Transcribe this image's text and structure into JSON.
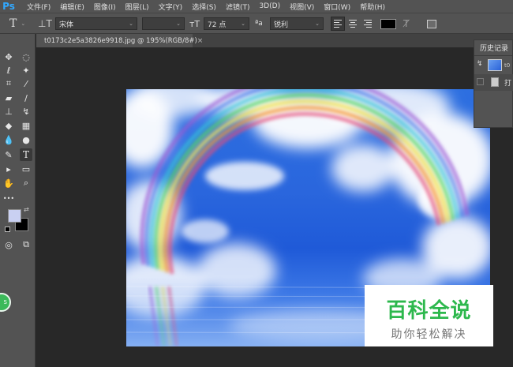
{
  "app": {
    "logo": "Ps"
  },
  "menu": [
    "文件(F)",
    "编辑(E)",
    "图像(I)",
    "图层(L)",
    "文字(Y)",
    "选择(S)",
    "滤镜(T)",
    "3D(D)",
    "视图(V)",
    "窗口(W)",
    "帮助(H)"
  ],
  "options": {
    "tool_glyph": "T",
    "font_family": "宋体",
    "font_style": "",
    "font_size": "72 点",
    "aa_label": "ªa",
    "antialias": "锐利",
    "text_color": "#000000"
  },
  "document": {
    "tab_title": "t0173c2e5a3826e9918.jpg @ 195%(RGB/8#)",
    "close": "×"
  },
  "history": {
    "title": "历史记录",
    "row1_text": "t0",
    "row2_text": "打"
  },
  "toolbar": {
    "dots": "•••"
  },
  "colors": {
    "foreground": "#c9d0f2",
    "background": "#000000",
    "accent": "#31a8ff"
  },
  "watermark": {
    "title": "百科全说",
    "subtitle": "助你轻松解决"
  },
  "badge": {
    "text": "S"
  }
}
